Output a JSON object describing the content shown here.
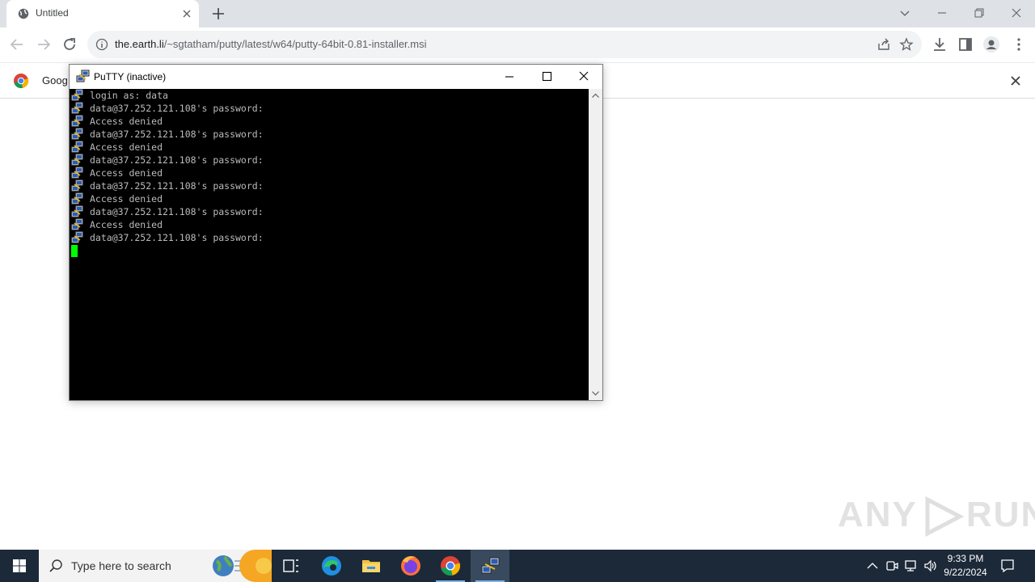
{
  "browser": {
    "tab": {
      "title": "Untitled"
    },
    "url": {
      "host": "the.earth.li",
      "path": "/~sgtatham/putty/latest/w64/putty-64bit-0.81-installer.msi"
    },
    "infobar": {
      "text": "Goog"
    }
  },
  "putty": {
    "title": "PuTTY (inactive)",
    "lines": [
      "login as: data",
      "data@37.252.121.108's password:",
      "Access denied",
      "data@37.252.121.108's password:",
      "Access denied",
      "data@37.252.121.108's password:",
      "Access denied",
      "data@37.252.121.108's password:",
      "Access denied",
      "data@37.252.121.108's password:",
      "Access denied",
      "data@37.252.121.108's password:"
    ]
  },
  "watermark": {
    "left": "ANY",
    "right": "RUN"
  },
  "taskbar": {
    "search_placeholder": "Type here to search",
    "clock": {
      "time": "9:33 PM",
      "date": "9/22/2024"
    }
  },
  "colors": {
    "terminal_bg": "#000000",
    "terminal_text": "#bbbbbb",
    "cursor": "#00ff00",
    "taskbar": "#1c2939"
  }
}
